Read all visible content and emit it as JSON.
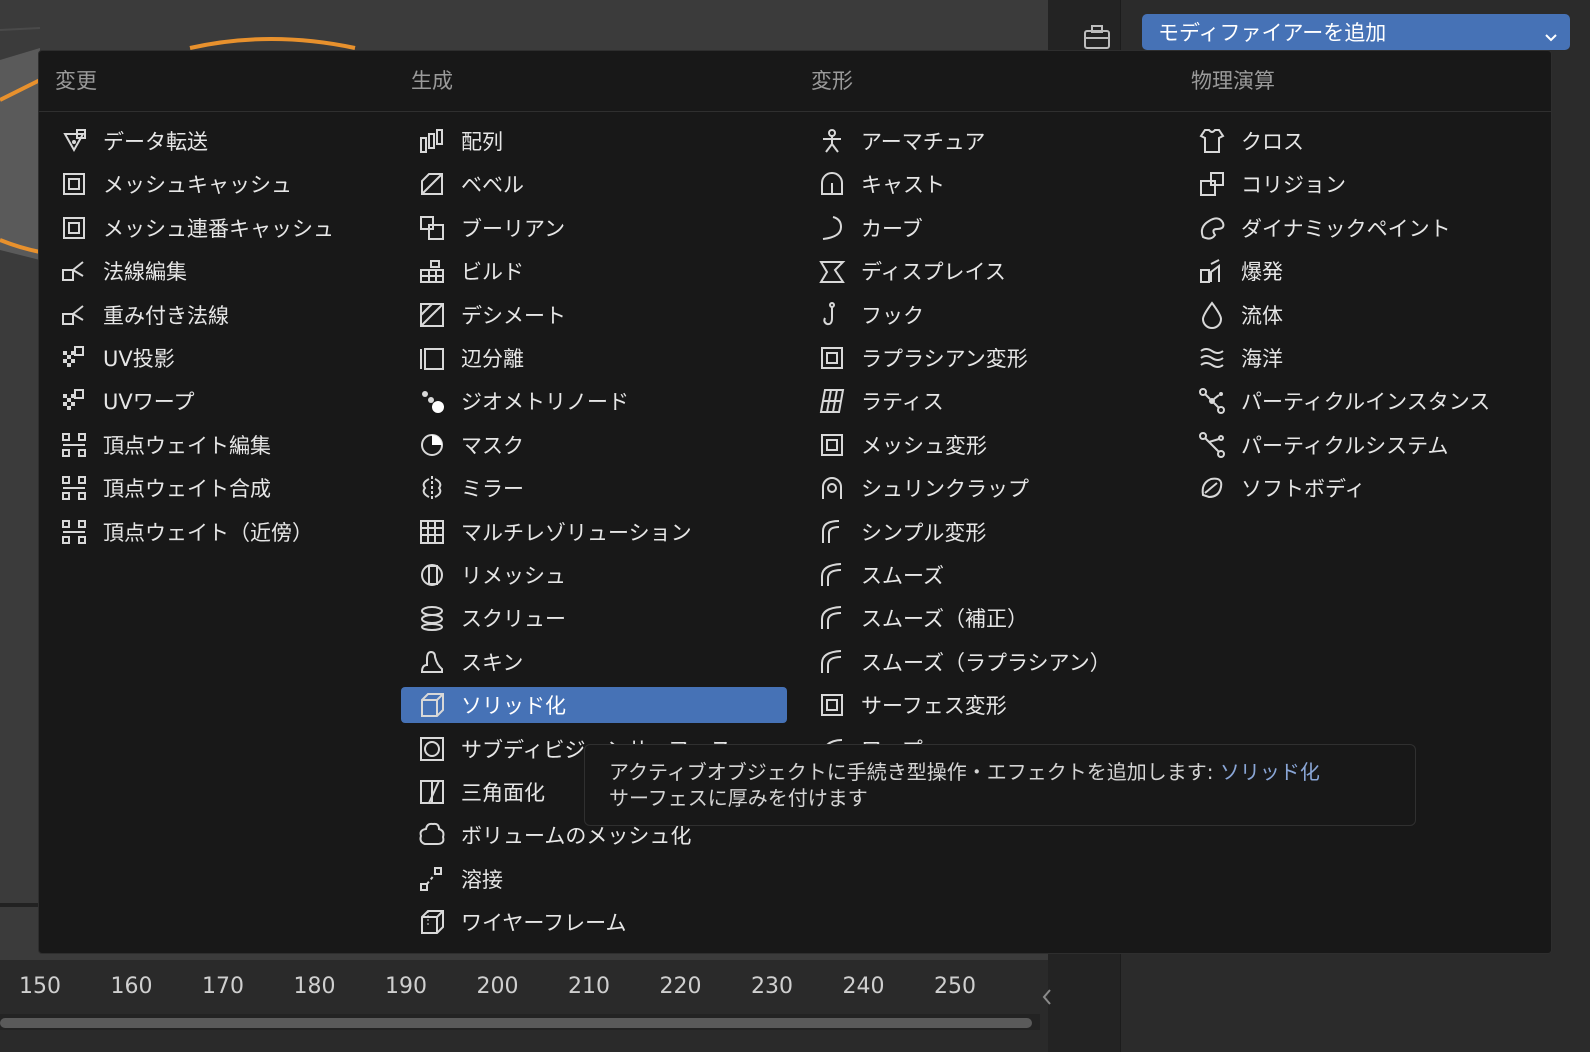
{
  "header": {
    "dropdown_label": "モディファイアーを追加"
  },
  "timeline": {
    "ticks": [
      "150",
      "160",
      "170",
      "180",
      "190",
      "200",
      "210",
      "220",
      "230",
      "240",
      "250"
    ]
  },
  "menu": {
    "columns": [
      {
        "header": "変更",
        "items": [
          {
            "label": "データ転送",
            "icon": "data-transfer-icon"
          },
          {
            "label": "メッシュキャッシュ",
            "icon": "mesh-cache-icon"
          },
          {
            "label": "メッシュ連番キャッシュ",
            "icon": "mesh-sequence-cache-icon"
          },
          {
            "label": "法線編集",
            "icon": "normal-edit-icon"
          },
          {
            "label": "重み付き法線",
            "icon": "weighted-normal-icon"
          },
          {
            "label": "UV投影",
            "icon": "uv-project-icon"
          },
          {
            "label": "UVワープ",
            "icon": "uv-warp-icon"
          },
          {
            "label": "頂点ウェイト編集",
            "icon": "vertex-weight-edit-icon"
          },
          {
            "label": "頂点ウェイト合成",
            "icon": "vertex-weight-mix-icon"
          },
          {
            "label": "頂点ウェイト（近傍）",
            "icon": "vertex-weight-proximity-icon"
          }
        ]
      },
      {
        "header": "生成",
        "items": [
          {
            "label": "配列",
            "icon": "array-icon"
          },
          {
            "label": "ベベル",
            "icon": "bevel-icon"
          },
          {
            "label": "ブーリアン",
            "icon": "boolean-icon"
          },
          {
            "label": "ビルド",
            "icon": "build-icon"
          },
          {
            "label": "デシメート",
            "icon": "decimate-icon"
          },
          {
            "label": "辺分離",
            "icon": "edge-split-icon"
          },
          {
            "label": "ジオメトリノード",
            "icon": "geometry-nodes-icon"
          },
          {
            "label": "マスク",
            "icon": "mask-icon"
          },
          {
            "label": "ミラー",
            "icon": "mirror-icon"
          },
          {
            "label": "マルチレゾリューション",
            "icon": "multires-icon"
          },
          {
            "label": "リメッシュ",
            "icon": "remesh-icon"
          },
          {
            "label": "スクリュー",
            "icon": "screw-icon"
          },
          {
            "label": "スキン",
            "icon": "skin-icon"
          },
          {
            "label": "ソリッド化",
            "icon": "solidify-icon",
            "selected": true
          },
          {
            "label": "サブディビジョンサーフェス",
            "icon": "subdivision-icon"
          },
          {
            "label": "三角面化",
            "icon": "triangulate-icon"
          },
          {
            "label": "ボリュームのメッシュ化",
            "icon": "volume-to-mesh-icon"
          },
          {
            "label": "溶接",
            "icon": "weld-icon"
          },
          {
            "label": "ワイヤーフレーム",
            "icon": "wireframe-icon"
          }
        ]
      },
      {
        "header": "変形",
        "items": [
          {
            "label": "アーマチュア",
            "icon": "armature-icon"
          },
          {
            "label": "キャスト",
            "icon": "cast-icon"
          },
          {
            "label": "カーブ",
            "icon": "curve-icon"
          },
          {
            "label": "ディスプレイス",
            "icon": "displace-icon"
          },
          {
            "label": "フック",
            "icon": "hook-icon"
          },
          {
            "label": "ラプラシアン変形",
            "icon": "laplacian-deform-icon"
          },
          {
            "label": "ラティス",
            "icon": "lattice-icon"
          },
          {
            "label": "メッシュ変形",
            "icon": "mesh-deform-icon"
          },
          {
            "label": "シュリンクラップ",
            "icon": "shrinkwrap-icon"
          },
          {
            "label": "シンプル変形",
            "icon": "simple-deform-icon"
          },
          {
            "label": "スムーズ",
            "icon": "smooth-icon"
          },
          {
            "label": "スムーズ（補正）",
            "icon": "smooth-corrective-icon"
          },
          {
            "label": "スムーズ（ラプラシアン）",
            "icon": "smooth-laplacian-icon"
          },
          {
            "label": "サーフェス変形",
            "icon": "surface-deform-icon"
          },
          {
            "label": "ワープ",
            "icon": "warp-icon"
          }
        ]
      },
      {
        "header": "物理演算",
        "items": [
          {
            "label": "クロス",
            "icon": "cloth-icon"
          },
          {
            "label": "コリジョン",
            "icon": "collision-icon"
          },
          {
            "label": "ダイナミックペイント",
            "icon": "dynamic-paint-icon"
          },
          {
            "label": "爆発",
            "icon": "explode-icon"
          },
          {
            "label": "流体",
            "icon": "fluid-icon"
          },
          {
            "label": "海洋",
            "icon": "ocean-icon"
          },
          {
            "label": "パーティクルインスタンス",
            "icon": "particle-instance-icon"
          },
          {
            "label": "パーティクルシステム",
            "icon": "particle-system-icon"
          },
          {
            "label": "ソフトボディ",
            "icon": "soft-body-icon"
          }
        ]
      }
    ]
  },
  "tooltip": {
    "text": "アクティブオブジェクトに手続き型操作・エフェクトを追加します:",
    "accent": "ソリッド化",
    "description": "サーフェスに厚みを付けます"
  }
}
